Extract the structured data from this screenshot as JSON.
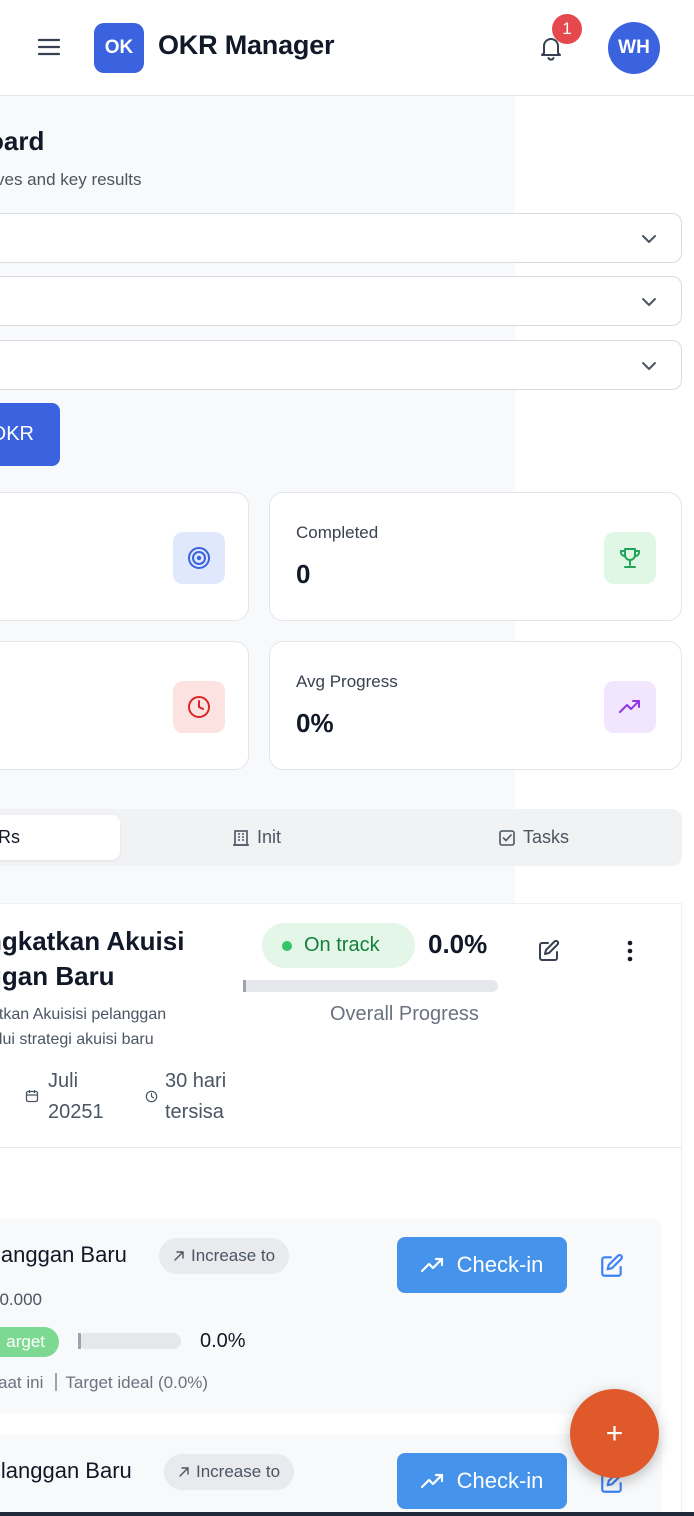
{
  "header": {
    "logo_text": "OK",
    "app_title": "OKR Manager",
    "notification_count": "1",
    "avatar_initials": "WH"
  },
  "page": {
    "title": "oard",
    "subtitle": "ves and key results"
  },
  "filters": {
    "select_1": "",
    "select_2": "",
    "select_3": ""
  },
  "create_button_label": "OKR",
  "stats": {
    "completed_label": "Completed",
    "completed_value": "0",
    "avg_progress_label": "Avg Progress",
    "avg_progress_value": "0%",
    "colors": {
      "target": "#e0e8fd",
      "trophy": "#e0f7e6",
      "clock": "#fde2e2",
      "trend": "#f1e6fd"
    }
  },
  "tabs": [
    {
      "label": "Rs",
      "icon": "",
      "active": true
    },
    {
      "label": "Init",
      "icon": "building-icon",
      "active": false
    },
    {
      "label": "Tasks",
      "icon": "check-square-icon",
      "active": false
    }
  ],
  "okr": {
    "title_line1": "ngkatkan Akuisi",
    "title_line2": "ggan Baru",
    "desc_line1": "atkan Akuisisi pelanggan",
    "desc_line2": "alui strategi akuisi baru",
    "date_line1": "Juli",
    "date_line2": "20251",
    "remaining_line1": "30 hari",
    "remaining_line2": "tersisa",
    "status": "On track",
    "progress_pct": "0.0%",
    "progress_value": 0,
    "overall_label": "Overall Progress"
  },
  "key_results": [
    {
      "title": "langgan Baru",
      "tag": "Increase to",
      "target_text": "00.000",
      "badge": "arget",
      "progress_pct": "0.0%",
      "progress_value": 0,
      "legend_current": "aat ini",
      "legend_ideal": "Target ideal (0.0%)",
      "checkin_label": "Check-in"
    },
    {
      "title": "llanggan Baru",
      "tag": "Increase to",
      "checkin_label": "Check-in"
    }
  ],
  "fab_label": "+"
}
